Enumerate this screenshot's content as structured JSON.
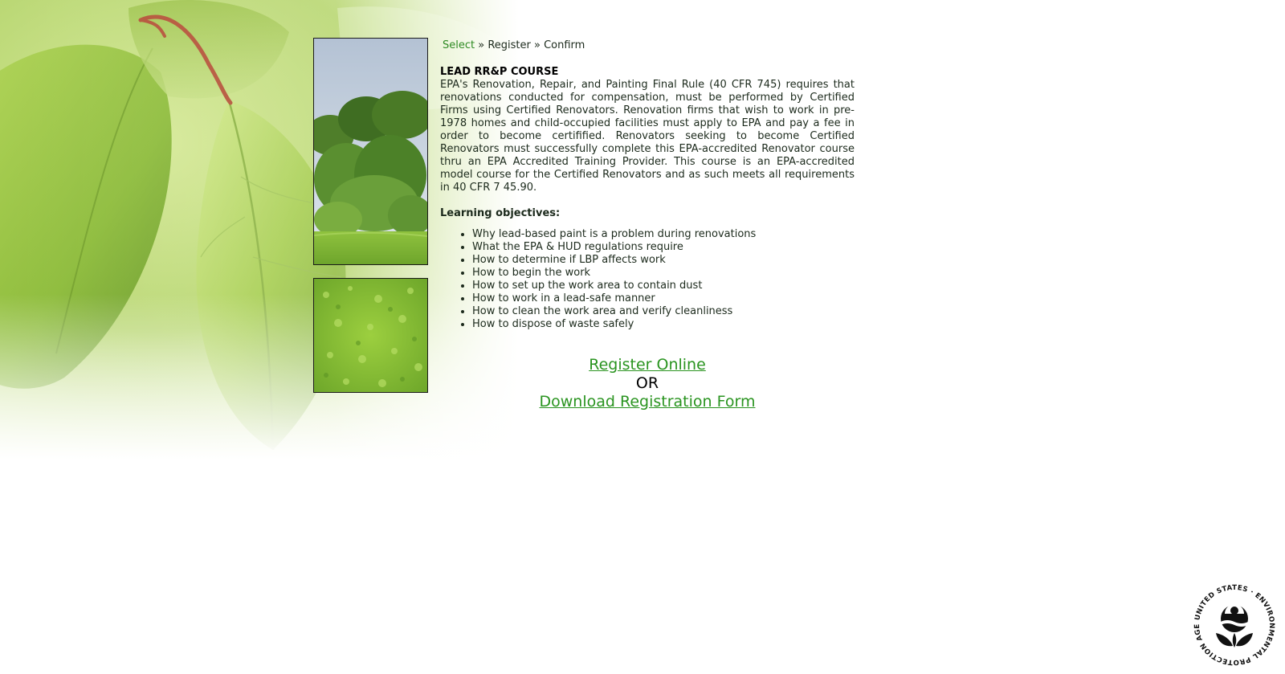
{
  "breadcrumb": {
    "step1": "Select",
    "sep1": " » ",
    "step2": "Register",
    "sep2": " » ",
    "step3": "Confirm"
  },
  "course": {
    "title": "LEAD RR&P COURSE",
    "description": "EPA's Renovation, Repair, and Painting Final Rule (40 CFR 745) requires that renovations conducted for compensation, must be performed by Certified Firms using Certified Renovators. Renovation firms that wish to work in pre-1978 homes and child-occupied facilities must apply to EPA and pay a fee in order to become certifified. Renovators seeking to become Certified Renovators must successfully complete this EPA-accredited Renovator course thru an EPA Accredited Training Provider. This course is an EPA-accredited model course for the Certified Renovators and as such meets all requirements in 40 CFR 7 45.90."
  },
  "objectives": {
    "heading": "Learning objectives:",
    "items": [
      "Why lead-based paint is a problem during renovations",
      "What the EPA & HUD regulations require",
      "How to determine if LBP affects work",
      "How to begin the work",
      "How to set up the work area to contain dust",
      "How to work in a lead-safe manner",
      "How to clean the work area and verify cleanliness",
      "How to dispose of waste safely"
    ]
  },
  "actions": {
    "register_online": "Register Online",
    "or": "OR",
    "download_form": "Download Registration Form"
  },
  "seal": {
    "text": "UNITED STATES · ENVIRONMENTAL PROTECTION AGENCY ·"
  },
  "colors": {
    "link": "#2a9420",
    "leaf_light": "#c9e27a",
    "leaf_dark": "#6d9a2c",
    "text": "#1c2a1c"
  },
  "icons": {
    "seal": "epa-seal-icon"
  }
}
